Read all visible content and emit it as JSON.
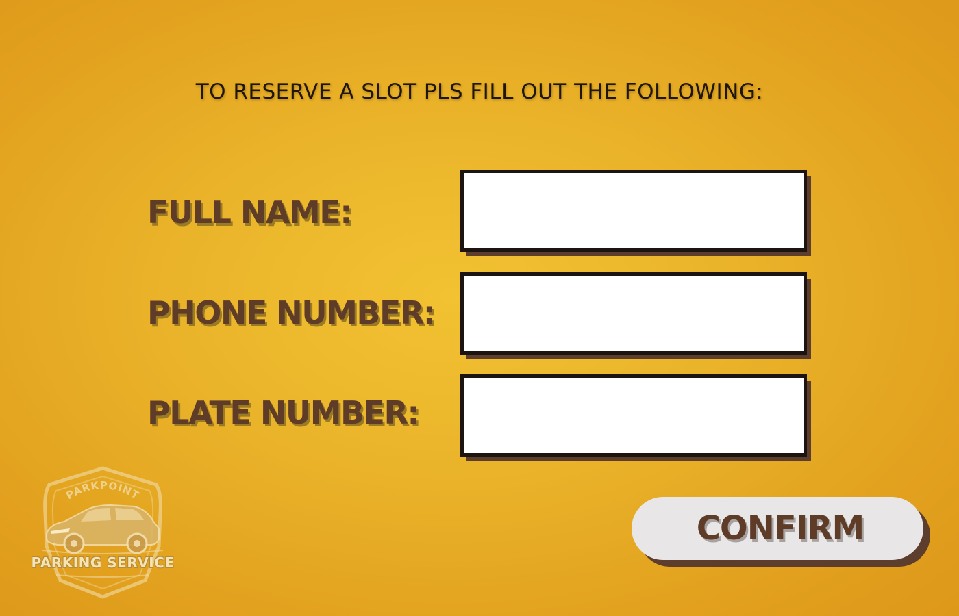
{
  "heading": "TO RESERVE A SLOT PLS FILL OUT THE FOLLOWING:",
  "form": {
    "fields": [
      {
        "label": "FULL NAME:",
        "value": "",
        "placeholder": ""
      },
      {
        "label": "PHONE NUMBER:",
        "value": "",
        "placeholder": ""
      },
      {
        "label": "PLATE NUMBER:",
        "value": "",
        "placeholder": ""
      }
    ],
    "confirm_label": "CONFIRM"
  },
  "logo": {
    "brand": "PARKPOINT",
    "tagline": "PARKING SERVICE",
    "icon": "car-shield-icon"
  },
  "colors": {
    "background": "#ebb62b",
    "label_text": "#5e3c28",
    "box_shadow": "#5d3d2c",
    "input_border": "#1b1410",
    "button_bg": "#e8e6e6"
  }
}
